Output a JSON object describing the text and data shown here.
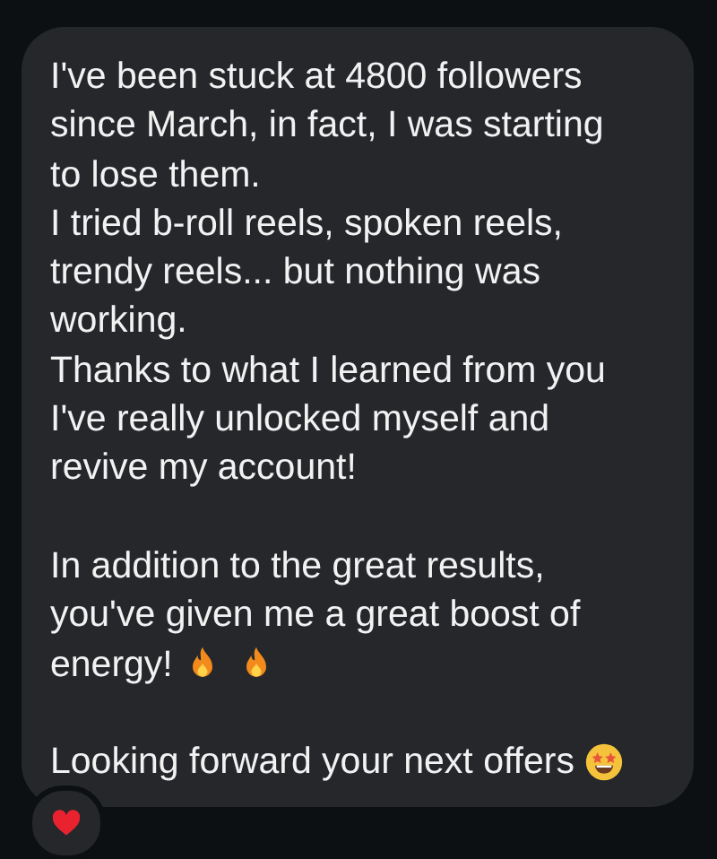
{
  "message": {
    "paragraphs": [
      {
        "lines": [
          "I've been stuck at 4800 followers",
          "since March, in fact, I was starting",
          "to lose them.",
          "I tried b-roll reels, spoken reels,",
          "trendy reels... but nothing was",
          "working.",
          "Thanks to what I learned from you",
          "I've really unlocked myself and",
          "revive my account!"
        ]
      },
      {
        "lines": [
          "In addition to the great results,",
          "you've given me a great boost of",
          "energy!"
        ],
        "icons": [
          {
            "kind": "fire"
          },
          {
            "kind": "fire"
          }
        ]
      },
      {
        "lines": [
          "Looking forward your next offers"
        ],
        "icons": [
          {
            "kind": "star-struck"
          }
        ]
      }
    ]
  },
  "reaction": {
    "kind": "heart"
  }
}
